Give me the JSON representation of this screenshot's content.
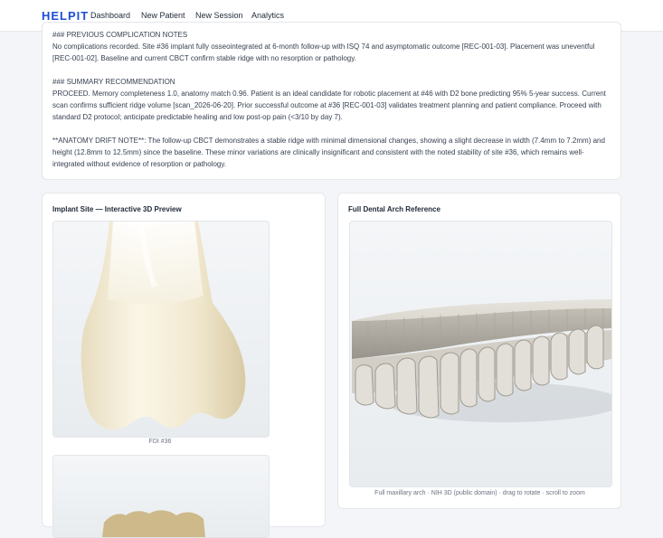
{
  "brand": "HELPIT",
  "nav": {
    "dashboard": "Dashboard",
    "new_patient": "New Patient",
    "new_session": "New Session",
    "analytics": "Analytics"
  },
  "summary": {
    "complication_heading": "### PREVIOUS COMPLICATION NOTES",
    "complication_text": "No complications recorded. Site #36 implant fully osseointegrated at 6-month follow-up with ISQ 74 and asymptomatic outcome [REC-001-03]. Placement was uneventful [REC-001-02]. Baseline and current CBCT confirm stable ridge with no resorption or pathology.",
    "recommendation_heading": "### SUMMARY RECOMMENDATION",
    "recommendation_text": "PROCEED. Memory completeness 1.0, anatomy match 0.96. Patient is an ideal candidate for robotic placement at #46 with D2 bone predicting 95% 5-year success. Current scan confirms sufficient ridge volume [scan_2026-06-20]. Prior successful outcome at #36 [REC-001-03] validates treatment planning and patient compliance. Proceed with standard D2 protocol; anticipate predictable healing and low post-op pain (<3/10 by day 7).",
    "drift_text": "**ANATOMY DRIFT NOTE**: The follow-up CBCT demonstrates a stable ridge with minimal dimensional changes, showing a slight decrease in width (7.4mm to 7.2mm) and height (12.8mm to 12.5mm) since the baseline. These minor variations are clinically insignificant and consistent with the noted stability of site #36, which remains well-integrated without evidence of resorption or pathology."
  },
  "implant_card": {
    "title": "Implant Site — Interactive 3D Preview",
    "caption": "FDI #36"
  },
  "arch_card": {
    "title": "Full Dental Arch Reference",
    "caption": "Full maxillary arch · NIH 3D (public domain) · drag to rotate · scroll to zoom"
  },
  "colors": {
    "brand": "#1d4ed8",
    "tooth": "#f1e8cf",
    "arch_model": "#d9d6cf"
  }
}
